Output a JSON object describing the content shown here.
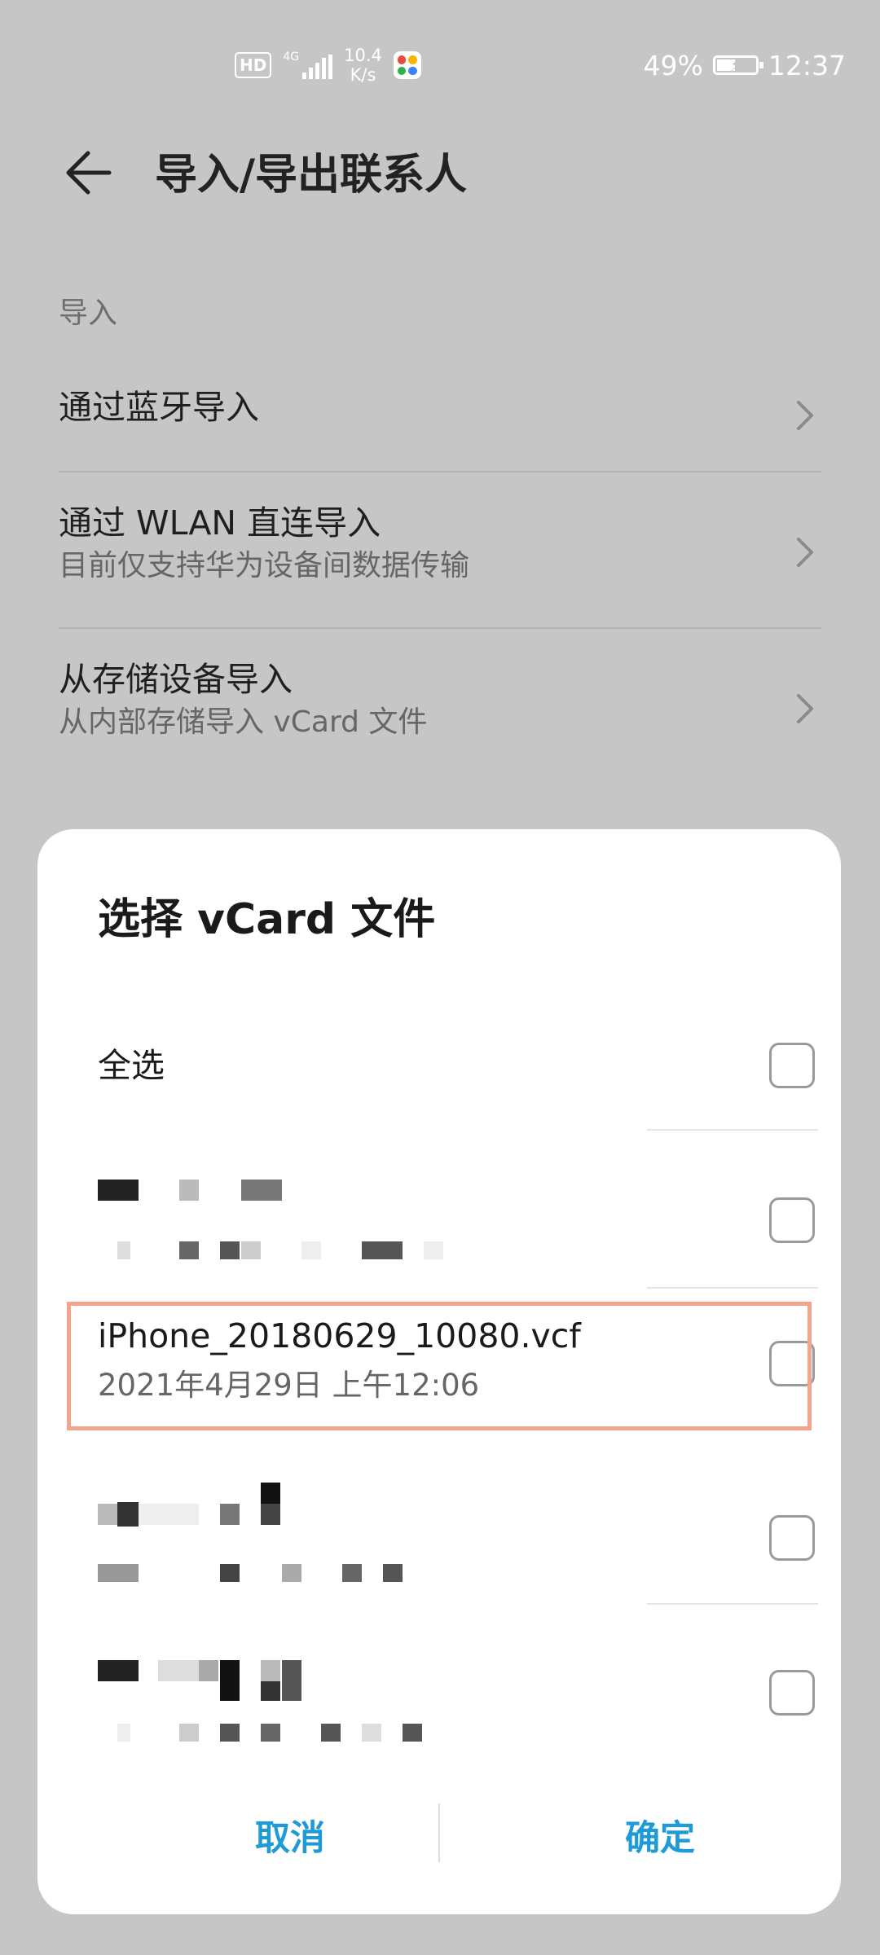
{
  "status_bar": {
    "hd": "HD",
    "network": "4G",
    "speed_value": "10.4",
    "speed_unit": "K/s",
    "battery": "49%",
    "time": "12:37"
  },
  "app_bar": {
    "title": "导入/导出联系人"
  },
  "import_section": {
    "header": "导入",
    "items": [
      {
        "title": "通过蓝牙导入",
        "subtitle": ""
      },
      {
        "title": "通过 WLAN 直连导入",
        "subtitle": "目前仅支持华为设备间数据传输"
      },
      {
        "title": "从存储设备导入",
        "subtitle": "从内部存储导入 vCard 文件"
      }
    ]
  },
  "dialog": {
    "title": "选择 vCard 文件",
    "select_all": "全选",
    "files": [
      {
        "name": "iPhone_20180629_10080.vcf",
        "date": "2021年4月29日 上午12:06"
      }
    ],
    "cancel": "取消",
    "confirm": "确定"
  },
  "colors": {
    "accent": "#1e9bd7",
    "highlight": "#f2a58b",
    "scrim": "#c6c6c6"
  }
}
